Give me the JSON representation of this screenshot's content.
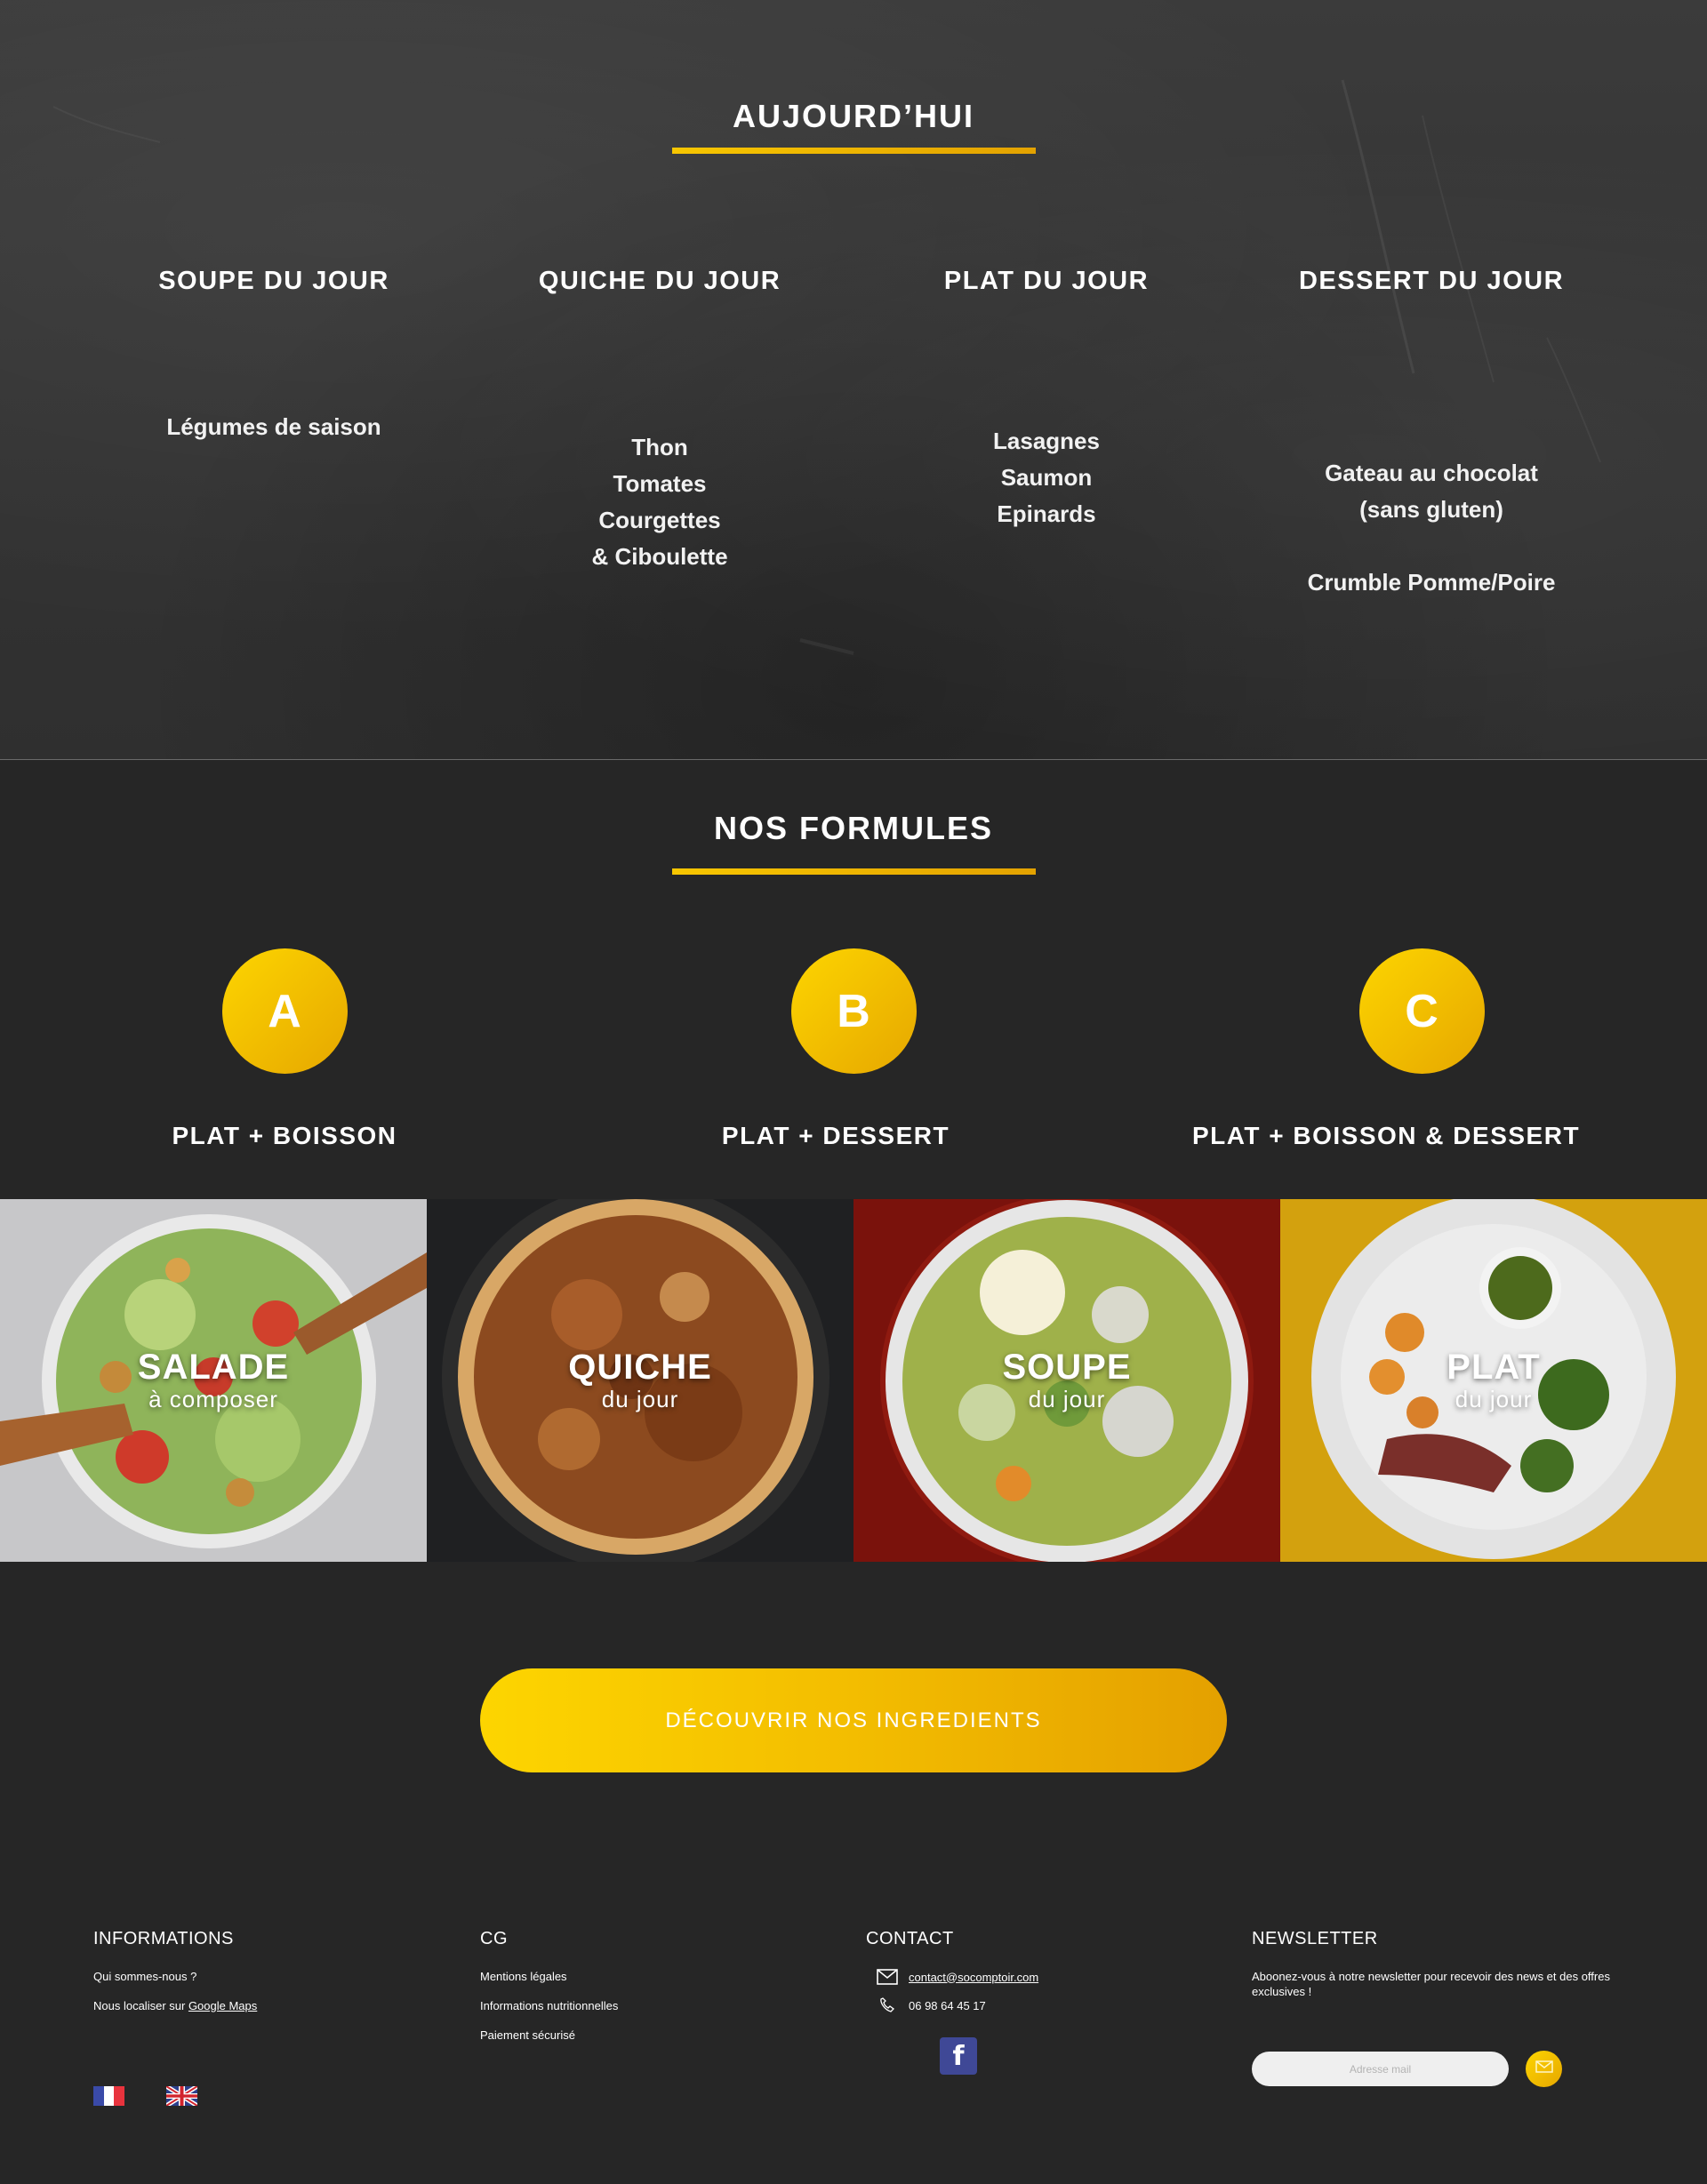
{
  "today": {
    "title": "AUJOURD’HUI",
    "columns": [
      {
        "heading": "SOUPE DU JOUR",
        "lines": [
          "Légumes de saison"
        ]
      },
      {
        "heading": "QUICHE DU JOUR",
        "lines": [
          "Thon",
          "Tomates",
          "Courgettes",
          "& Ciboulette"
        ]
      },
      {
        "heading": "PLAT DU JOUR",
        "lines": [
          "Lasagnes",
          "Saumon",
          "Epinards"
        ]
      },
      {
        "heading": "DESSERT DU JOUR",
        "lines": [
          "Gateau au chocolat",
          "(sans gluten)",
          "",
          "Crumble Pomme/Poire"
        ]
      }
    ]
  },
  "formules": {
    "title": "NOS FORMULES",
    "items": [
      {
        "letter": "A",
        "label": "PLAT + BOISSON"
      },
      {
        "letter": "B",
        "label": "PLAT + DESSERT"
      },
      {
        "letter": "C",
        "label": "PLAT + BOISSON & DESSERT"
      }
    ]
  },
  "tiles": [
    {
      "big": "SALADE",
      "small": "à composer"
    },
    {
      "big": "QUICHE",
      "small": "du jour"
    },
    {
      "big": "SOUPE",
      "small": "du jour"
    },
    {
      "big": "PLAT",
      "small": "du jour"
    }
  ],
  "cta": {
    "label": "DÉCOUVRIR NOS INGREDIENTS"
  },
  "footer": {
    "informations": {
      "title": "INFORMATIONS",
      "about": "Qui sommes-nous ?",
      "locate_prefix": "Nous localiser  sur ",
      "locate_link": "Google Maps"
    },
    "cg": {
      "title": "CG",
      "links": [
        "Mentions légales",
        "Informations nutritionnelles",
        "Paiement sécurisé"
      ]
    },
    "contact": {
      "title": "CONTACT",
      "email": "contact@socomptoir.com",
      "phone": "06 98 64 45 17",
      "facebook_glyph": "f"
    },
    "newsletter": {
      "title": "NEWSLETTER",
      "text": "Aboonez-vous à notre newsletter pour recevoir des news et des offres exclusives !",
      "placeholder": "Adresse mail"
    }
  },
  "colors": {
    "accent_start": "#fdd500",
    "accent_end": "#e4a000",
    "background": "#262626",
    "facebook": "#3f4896"
  },
  "icons": [
    "mail-icon",
    "phone-icon",
    "facebook-icon",
    "send-icon",
    "flag-fr-icon",
    "flag-uk-icon"
  ]
}
